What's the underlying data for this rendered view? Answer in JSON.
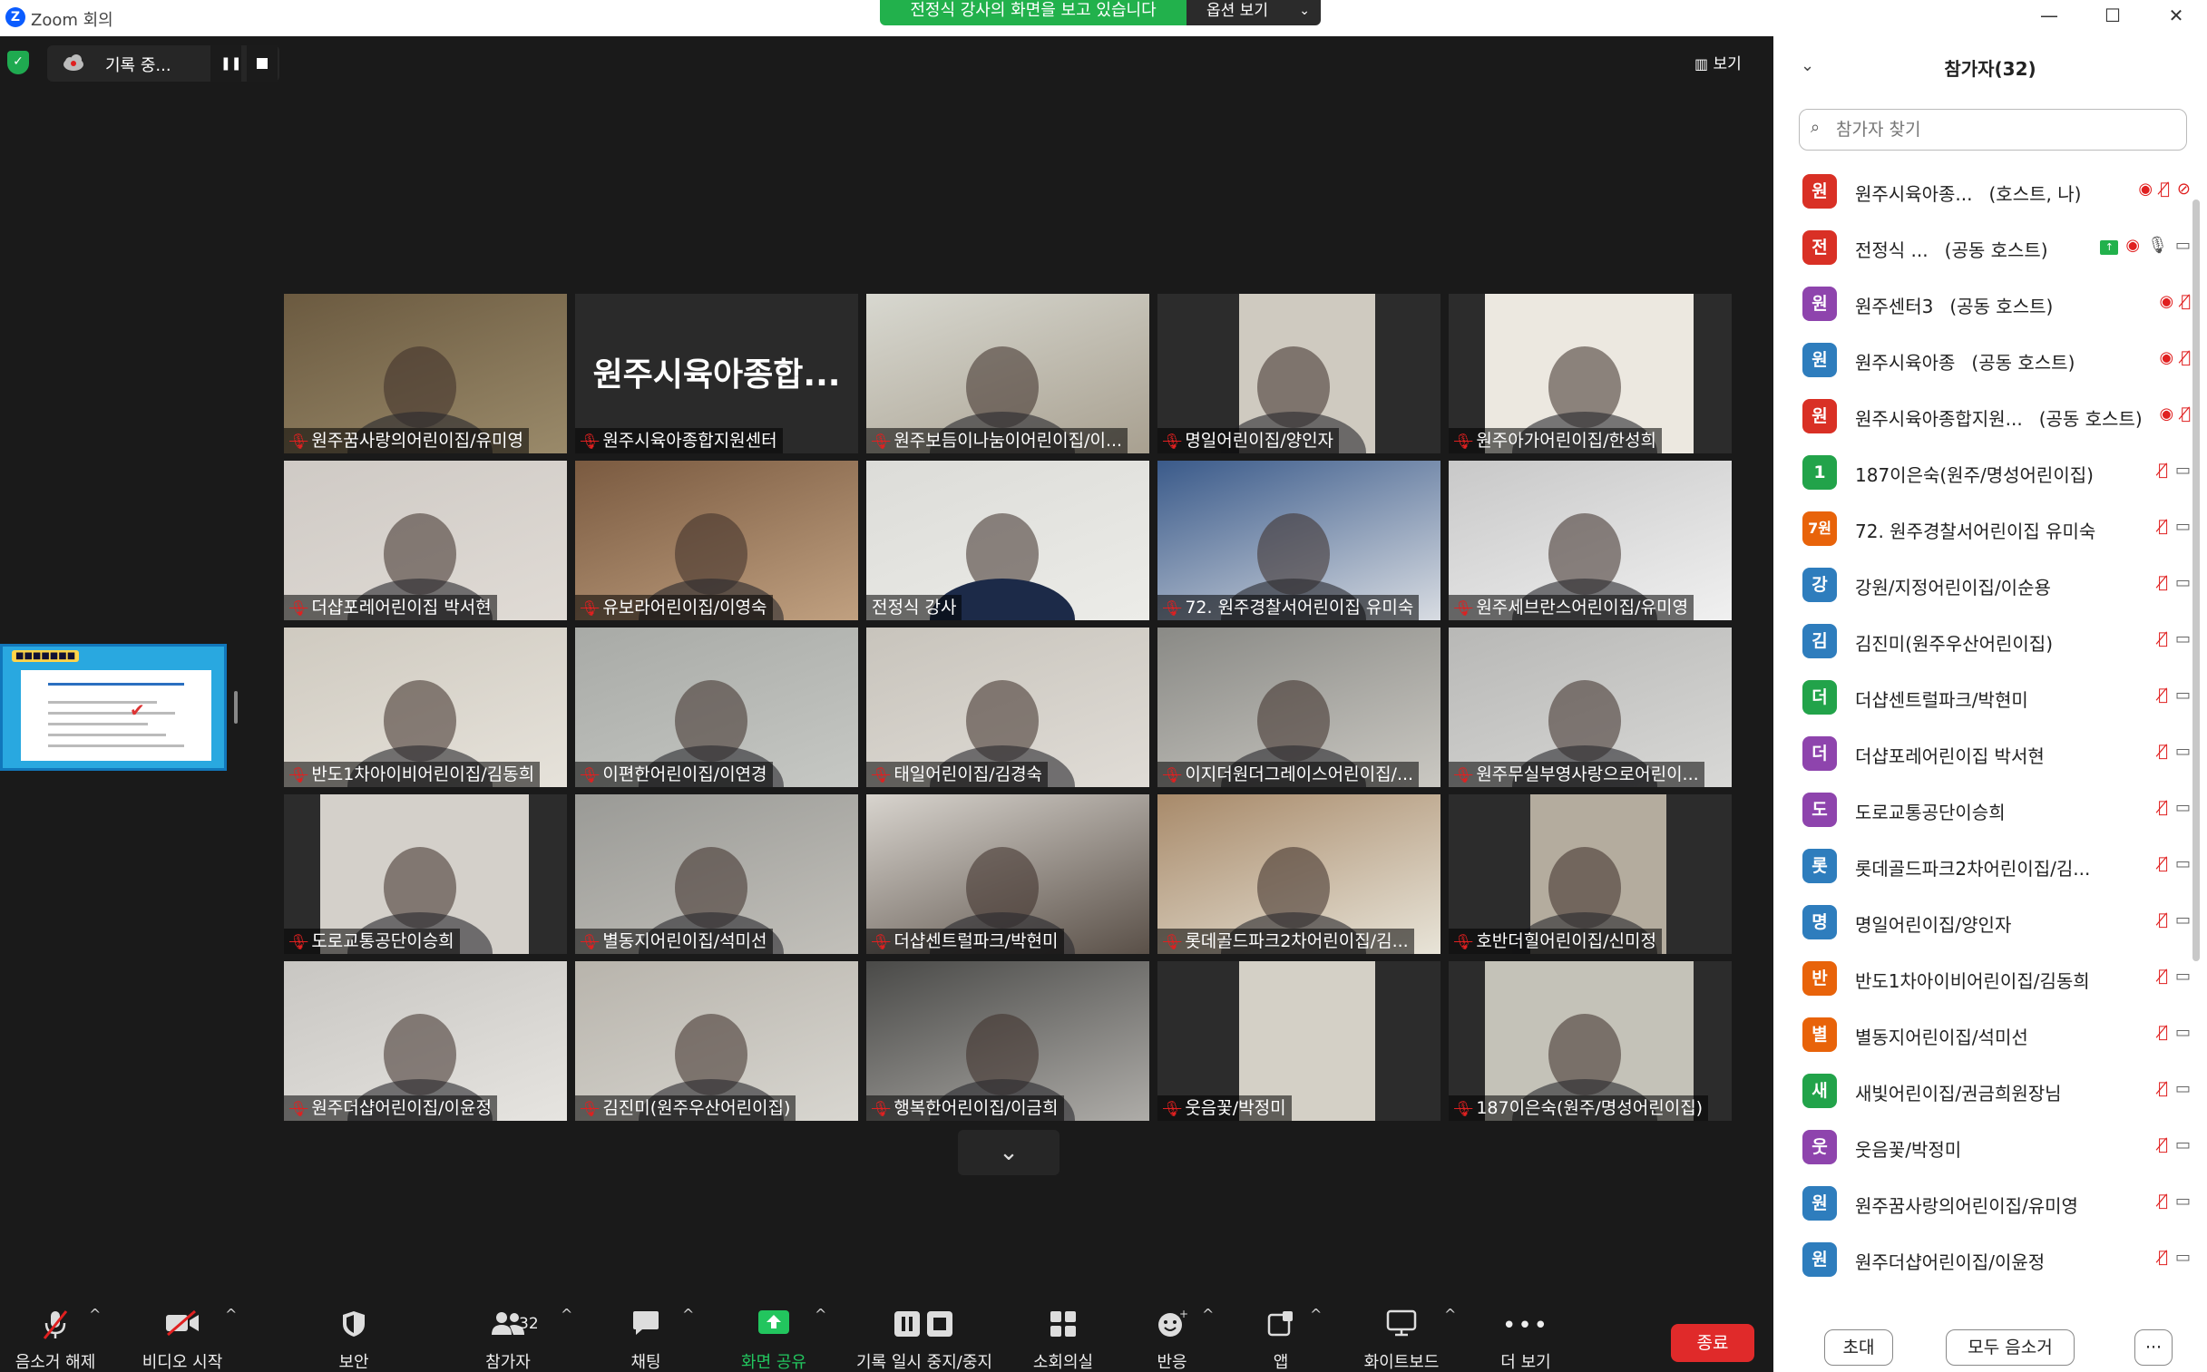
{
  "window": {
    "title": "Zoom 회의",
    "banner": "전정식 강사의 화면을 보고 있습니다",
    "options": "옵션 보기",
    "minimize": "—",
    "maximize": "☐",
    "close": "✕"
  },
  "recording": {
    "label": "기록 중..."
  },
  "view_button": "보기",
  "main_name": "원주시육아종합...",
  "tiles": [
    {
      "name": "원주꿈사랑의어린이집/유미영"
    },
    {
      "name": "원주시육아종합지원센터"
    },
    {
      "name": "원주보듬이나눔이어린이집/이..."
    },
    {
      "name": "명일어린이집/양인자"
    },
    {
      "name": "원주아가어린이집/한성희"
    },
    {
      "name": "더샵포레어린이집 박서현"
    },
    {
      "name": "유보라어린이집/이영숙"
    },
    {
      "name": "전정식 강사"
    },
    {
      "name": "72. 원주경찰서어린이집 유미숙"
    },
    {
      "name": "원주세브란스어린이집/유미영"
    },
    {
      "name": "반도1차아이비어린이집/김동희"
    },
    {
      "name": "이편한어린이집/이연경"
    },
    {
      "name": "태일어린이집/김경숙"
    },
    {
      "name": "이지더원더그레이스어린이집/..."
    },
    {
      "name": "원주무실부영사랑으로어린이..."
    },
    {
      "name": "도로교통공단이승희"
    },
    {
      "name": "별동지어린이집/석미선"
    },
    {
      "name": "더샵센트럴파크/박현미"
    },
    {
      "name": "롯데골드파크2차어린이집/김..."
    },
    {
      "name": "호반더힐어린이집/신미정"
    },
    {
      "name": "원주더샵어린이집/이윤정"
    },
    {
      "name": "김진미(원주우산어린이집)"
    },
    {
      "name": "행복한어린이집/이금희"
    },
    {
      "name": "웃음꽃/박정미"
    },
    {
      "name": "187이은숙(원주/명성어린이집)"
    }
  ],
  "toolbar": {
    "mute": "음소거 해제",
    "video": "비디오 시작",
    "security": "보안",
    "participants": "참가자",
    "participants_count": "32",
    "chat": "채팅",
    "share": "화면 공유",
    "record": "기록 일시 중지/중지",
    "breakout": "소회의실",
    "reactions": "반응",
    "apps": "앱",
    "whiteboard": "화이트보드",
    "more": "더 보기",
    "end": "종료"
  },
  "panel": {
    "title": "참가자(32)",
    "search_placeholder": "참가자 찾기",
    "invite": "초대",
    "mute_all": "모두 음소거",
    "more": "···",
    "participants": [
      {
        "avatar": "원",
        "color": "#d93025",
        "name": "원주시육아종...",
        "role": "(호스트, 나)"
      },
      {
        "avatar": "전",
        "color": "#d93025",
        "name": "전정식 ...",
        "role": "(공동 호스트)"
      },
      {
        "avatar": "원",
        "color": "#8e44ad",
        "name": "원주센터3",
        "role": "(공동 호스트)"
      },
      {
        "avatar": "원",
        "color": "#2e7dbd",
        "name": "원주시육아종",
        "role": "(공동 호스트)"
      },
      {
        "avatar": "원",
        "color": "#d93025",
        "name": "원주시육아종합지원...",
        "role": "(공동 호스트)"
      },
      {
        "avatar": "1",
        "color": "#22a34a",
        "name": "187이은숙(원주/명성어린이집)",
        "role": ""
      },
      {
        "avatar": "7원",
        "color": "#e8630a",
        "name": "72. 원주경찰서어린이집 유미숙",
        "role": ""
      },
      {
        "avatar": "강",
        "color": "#2e7dbd",
        "name": "강원/지정어린이집/이순용",
        "role": ""
      },
      {
        "avatar": "김",
        "color": "#2e7dbd",
        "name": "김진미(원주우산어린이집)",
        "role": ""
      },
      {
        "avatar": "더",
        "color": "#22a34a",
        "name": "더샵센트럴파크/박현미",
        "role": ""
      },
      {
        "avatar": "더",
        "color": "#8e44ad",
        "name": "더샵포레어린이집 박서현",
        "role": ""
      },
      {
        "avatar": "도",
        "color": "#8e44ad",
        "name": "도로교통공단이승희",
        "role": ""
      },
      {
        "avatar": "롯",
        "color": "#2e7dbd",
        "name": "롯데골드파크2차어린이집/김...",
        "role": ""
      },
      {
        "avatar": "명",
        "color": "#2e7dbd",
        "name": "명일어린이집/양인자",
        "role": ""
      },
      {
        "avatar": "반",
        "color": "#e8630a",
        "name": "반도1차아이비어린이집/김동희",
        "role": ""
      },
      {
        "avatar": "별",
        "color": "#e8630a",
        "name": "별동지어린이집/석미선",
        "role": ""
      },
      {
        "avatar": "새",
        "color": "#22a34a",
        "name": "새빛어린이집/권금희원장님",
        "role": ""
      },
      {
        "avatar": "웃",
        "color": "#8e44ad",
        "name": "웃음꽃/박정미",
        "role": ""
      },
      {
        "avatar": "원",
        "color": "#2e7dbd",
        "name": "원주꿈사랑의어린이집/유미영",
        "role": ""
      },
      {
        "avatar": "원",
        "color": "#2e7dbd",
        "name": "원주더샵어린이집/이윤정",
        "role": ""
      },
      {
        "avatar": "원",
        "color": "#d93025",
        "name": "원주무실부영사랑으로어린이...",
        "role": ""
      }
    ]
  }
}
